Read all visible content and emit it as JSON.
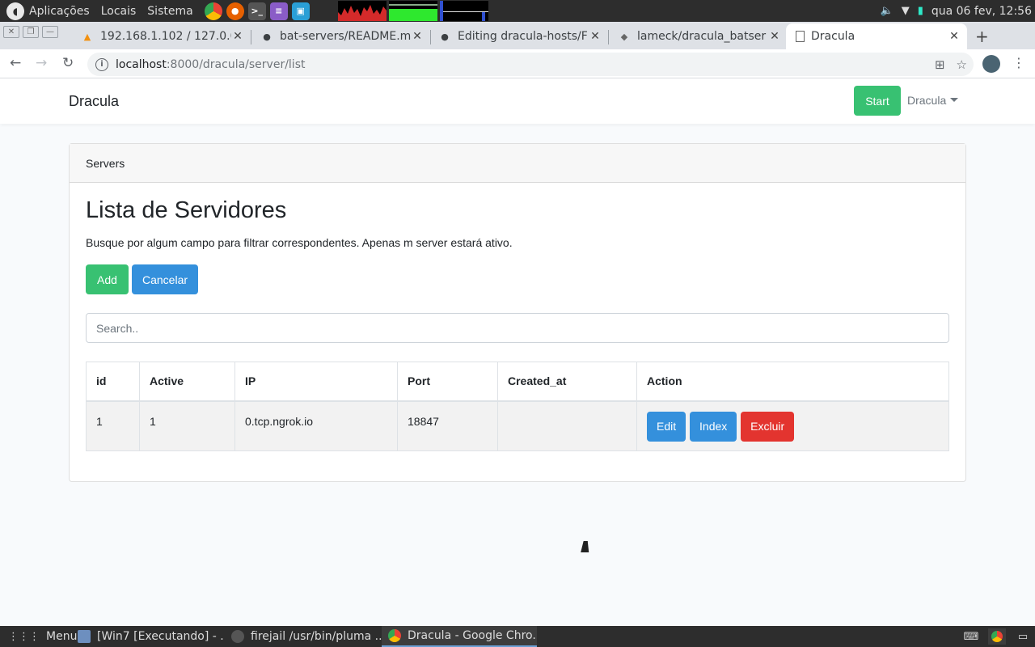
{
  "os_top": {
    "menus": [
      "Aplicações",
      "Locais",
      "Sistema"
    ],
    "clock": "qua 06 fev, 12:56"
  },
  "tabs": [
    {
      "title": "192.168.1.102 / 127.0.0.",
      "icon": "phpmyadmin-icon"
    },
    {
      "title": "bat-servers/README.m",
      "icon": "github-icon"
    },
    {
      "title": "Editing dracula-hosts/F",
      "icon": "github-icon"
    },
    {
      "title": "lameck/dracula_batser",
      "icon": "gitlab-icon"
    },
    {
      "title": "Dracula",
      "icon": "page-icon"
    }
  ],
  "address": {
    "host": "localhost",
    "path": ":8000/dracula/server/list"
  },
  "navbar": {
    "brand": "Dracula",
    "start_label": "Start",
    "user_label": "Dracula"
  },
  "card": {
    "header": "Servers",
    "title": "Lista de Servidores",
    "lead": "Busque por algum campo para filtrar correspondentes. Apenas m server estará ativo.",
    "add_label": "Add",
    "cancel_label": "Cancelar",
    "search_placeholder": "Search.."
  },
  "table": {
    "headers": [
      "id",
      "Active",
      "IP",
      "Port",
      "Created_at",
      "Action"
    ],
    "rows": [
      {
        "id": "1",
        "active": "1",
        "ip": "0.tcp.ngrok.io",
        "port": "18847",
        "created_at": ""
      }
    ],
    "actions": {
      "edit": "Edit",
      "index": "Index",
      "delete": "Excluir"
    }
  },
  "taskbar": {
    "menu_label": "Menu",
    "tasks": [
      "[Win7 [Executando] - ...",
      "firejail /usr/bin/pluma ...",
      "Dracula - Google Chro..."
    ]
  },
  "colors": {
    "success": "#38c172",
    "primary": "#3490dc",
    "danger": "#e3342f"
  }
}
